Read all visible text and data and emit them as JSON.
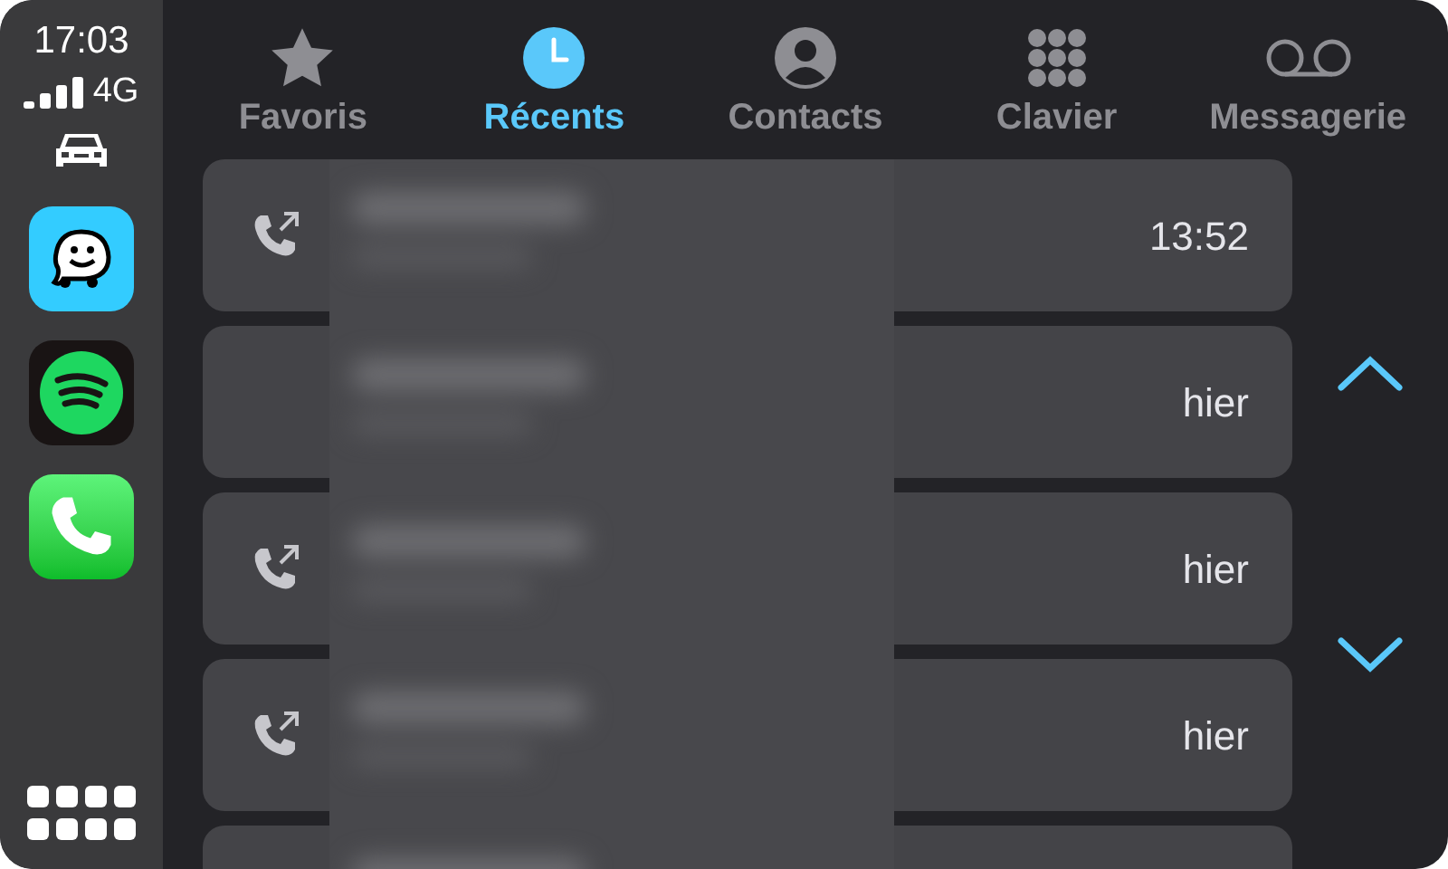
{
  "status": {
    "time": "17:03",
    "network": "4G"
  },
  "tabs": [
    {
      "label": "Favoris",
      "selected": false
    },
    {
      "label": "Récents",
      "selected": true
    },
    {
      "label": "Contacts",
      "selected": false
    },
    {
      "label": "Clavier",
      "selected": false
    },
    {
      "label": "Messagerie",
      "selected": false
    }
  ],
  "calls": [
    {
      "outgoing": true,
      "time": "13:52"
    },
    {
      "outgoing": false,
      "time": "hier"
    },
    {
      "outgoing": true,
      "time": "hier"
    },
    {
      "outgoing": true,
      "time": "hier"
    },
    {
      "outgoing": false
    }
  ]
}
